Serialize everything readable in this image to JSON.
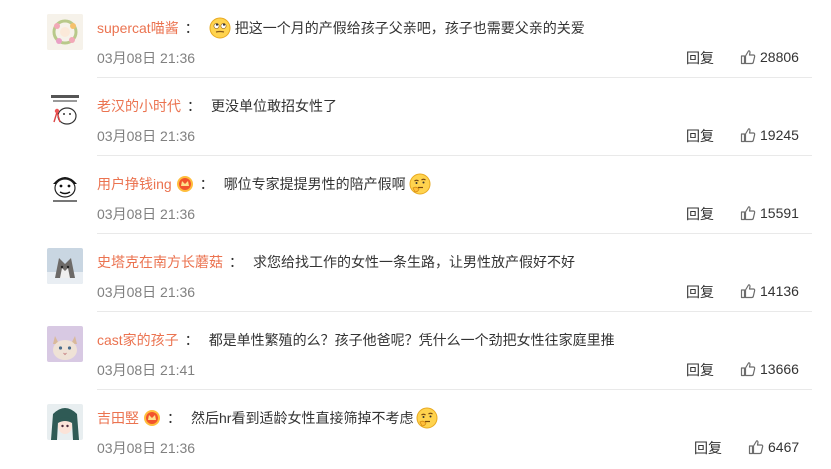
{
  "comments": [
    {
      "username": "supercat喵酱",
      "badge": "",
      "text": "把这一个月的产假给孩子父亲吧，孩子也需要父亲的关爱",
      "emoji_before": "rolling-eyes-emoji",
      "emoji_after": "",
      "time": "03月08日 21:36",
      "reply": "回复",
      "likes": "28806"
    },
    {
      "username": "老汉的小时代",
      "badge": "",
      "text": "更没单位敢招女性了",
      "emoji_before": "",
      "emoji_after": "",
      "time": "03月08日 21:36",
      "reply": "回复",
      "likes": "19245"
    },
    {
      "username": "用户挣钱ing",
      "badge": "crown-badge",
      "text": "哪位专家提提男性的陪产假啊",
      "emoji_before": "",
      "emoji_after": "thinking-emoji",
      "time": "03月08日 21:36",
      "reply": "回复",
      "likes": "15591"
    },
    {
      "username": "史塔克在南方长蘑菇",
      "badge": "",
      "text": "求您给找工作的女性一条生路，让男性放产假好不好",
      "emoji_before": "",
      "emoji_after": "",
      "time": "03月08日 21:36",
      "reply": "回复",
      "likes": "14136"
    },
    {
      "username": "cast家的孩子",
      "badge": "",
      "text": "都是单性繁殖的么？孩子他爸呢？凭什么一个劲把女性往家庭里推",
      "emoji_before": "",
      "emoji_after": "",
      "time": "03月08日 21:41",
      "reply": "回复",
      "likes": "13666"
    },
    {
      "username": "吉田竪",
      "badge": "crown-badge",
      "text": "然后hr看到适龄女性直接筛掉不考虑",
      "emoji_before": "",
      "emoji_after": "thinking-emoji",
      "time": "03月08日 21:36",
      "reply": "回复",
      "likes": "6467"
    }
  ],
  "colors": {
    "username": "#eb7350",
    "text": "#333333",
    "time": "#808080",
    "divider": "#e9e9e9"
  }
}
